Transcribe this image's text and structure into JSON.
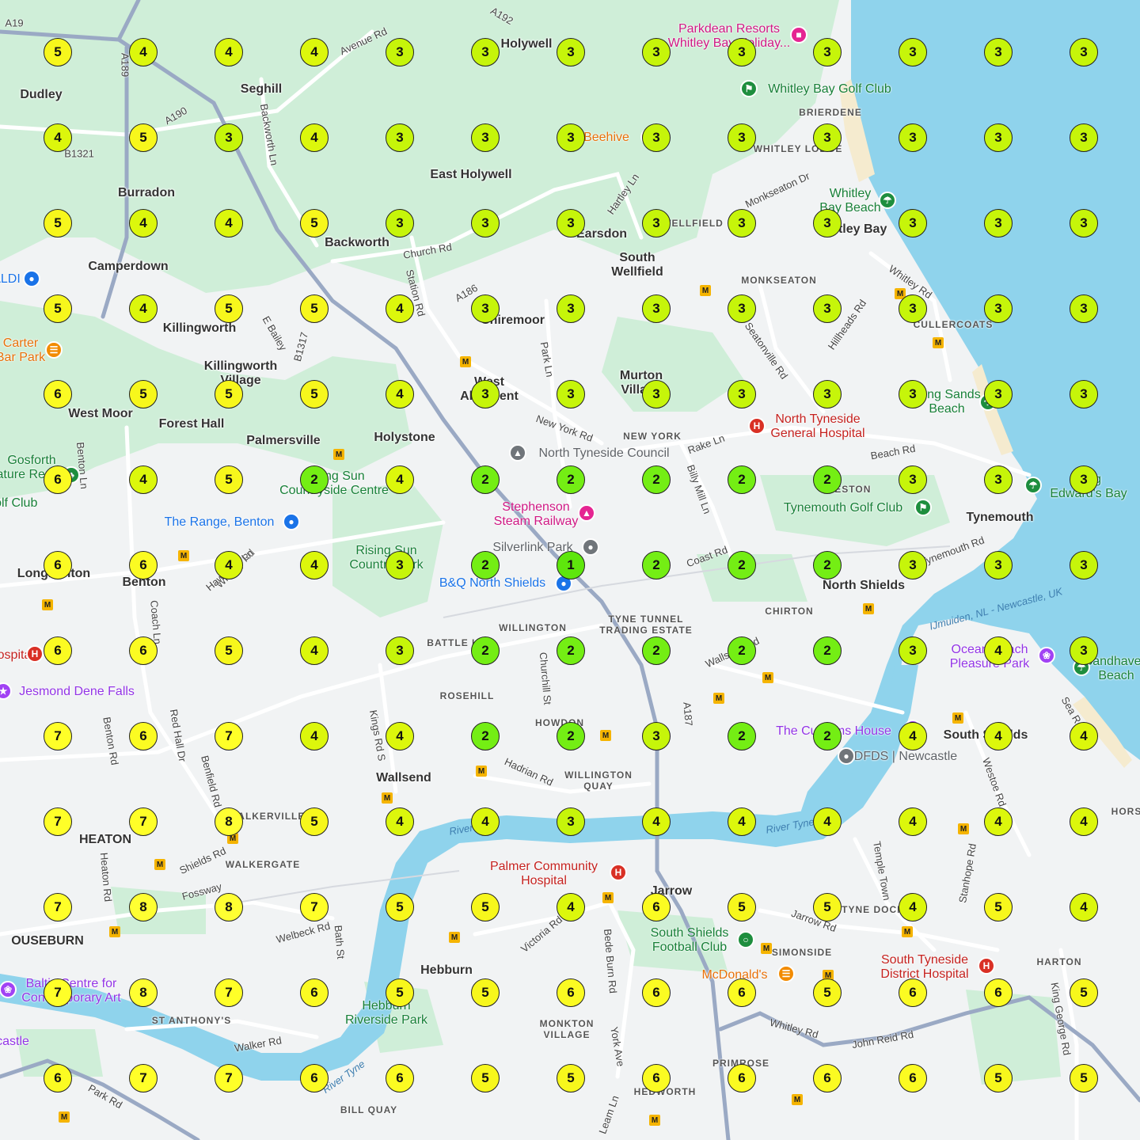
{
  "map": {
    "colors": {
      "land": "#f1f3f4",
      "green": "#c9efd3",
      "sea": "#8fd3ec",
      "road": "#ffffff",
      "major_road": "#9aa9c4",
      "beach": "#f5ebcf"
    },
    "place_labels": [
      {
        "text": "Dudley"
      },
      {
        "text": "Seghill"
      },
      {
        "text": "Holywell"
      },
      {
        "text": "East Holywell"
      },
      {
        "text": "Burradon"
      },
      {
        "text": "Backworth"
      },
      {
        "text": "Earsdon"
      },
      {
        "text": "South\nWellfield"
      },
      {
        "text": "Camperdown"
      },
      {
        "text": "Killingworth"
      },
      {
        "text": "Killingworth\nVillage"
      },
      {
        "text": "Shiremoor"
      },
      {
        "text": "West\nAllotment"
      },
      {
        "text": "Murton\nVillage"
      },
      {
        "text": "West Moor"
      },
      {
        "text": "Forest Hall"
      },
      {
        "text": "Palmersville"
      },
      {
        "text": "Holystone"
      },
      {
        "text": "Whitley Bay"
      },
      {
        "text": "Tynemouth"
      },
      {
        "text": "Longbenton"
      },
      {
        "text": "Benton"
      },
      {
        "text": "North Shields"
      },
      {
        "text": "Wallsend"
      },
      {
        "text": "HEATON"
      },
      {
        "text": "Jarrow"
      },
      {
        "text": "Hebburn"
      },
      {
        "text": "South Shields"
      },
      {
        "text": "OUSEBURN"
      }
    ],
    "area_labels": [
      {
        "text": "BRIERDENE"
      },
      {
        "text": "WHITLEY LODGE"
      },
      {
        "text": "WELLFIELD"
      },
      {
        "text": "MONKSEATON"
      },
      {
        "text": "CULLERCOATS"
      },
      {
        "text": "NEW YORK"
      },
      {
        "text": "PRESTON"
      },
      {
        "text": "CHIRTON"
      },
      {
        "text": "WILLINGTON"
      },
      {
        "text": "TYNE TUNNEL\nTRADING ESTATE"
      },
      {
        "text": "BATTLE HILL"
      },
      {
        "text": "ROSEHILL"
      },
      {
        "text": "HOWDON"
      },
      {
        "text": "WILLINGTON\nQUAY"
      },
      {
        "text": "WALKERVILLE"
      },
      {
        "text": "WALKERGATE"
      },
      {
        "text": "TYNE DOCK"
      },
      {
        "text": "SIMONSIDE"
      },
      {
        "text": "HARTON"
      },
      {
        "text": "ST ANTHONY'S"
      },
      {
        "text": "MONKTON\nVILLAGE"
      },
      {
        "text": "PRIMROSE"
      },
      {
        "text": "HEDWORTH"
      },
      {
        "text": "BILL QUAY"
      },
      {
        "text": "HORS"
      }
    ],
    "road_labels": [
      {
        "text": "A19"
      },
      {
        "text": "A189"
      },
      {
        "text": "A190"
      },
      {
        "text": "B1321"
      },
      {
        "text": "Avenue Rd"
      },
      {
        "text": "Backworth Ln"
      },
      {
        "text": "Church Rd"
      },
      {
        "text": "Station Rd"
      },
      {
        "text": "A186"
      },
      {
        "text": "Hartley Ln"
      },
      {
        "text": "Monkseaton Dr"
      },
      {
        "text": "Whitley Rd"
      },
      {
        "text": "Hillheads Rd"
      },
      {
        "text": "Seatonville Rd"
      },
      {
        "text": "Park Ln"
      },
      {
        "text": "New York Rd"
      },
      {
        "text": "Rake Ln"
      },
      {
        "text": "Billy Mill Ln"
      },
      {
        "text": "Beach Rd"
      },
      {
        "text": "Coast Rd"
      },
      {
        "text": "Tynemouth Rd"
      },
      {
        "text": "B1317"
      },
      {
        "text": "E Bailey"
      },
      {
        "text": "Benton Ln"
      },
      {
        "text": "Coach Ln"
      },
      {
        "text": "Whitley Rd"
      },
      {
        "text": "Churchill St"
      },
      {
        "text": "Kings Rd S"
      },
      {
        "text": "Hadrian Rd"
      },
      {
        "text": "A187"
      },
      {
        "text": "Red Hall Dr"
      },
      {
        "text": "Benfield Rd"
      },
      {
        "text": "Benton Rd"
      },
      {
        "text": "Heaton Rd"
      },
      {
        "text": "Shields Rd"
      },
      {
        "text": "Fossway"
      },
      {
        "text": "Welbeck Rd"
      },
      {
        "text": "Bath St"
      },
      {
        "text": "Victoria Rd"
      },
      {
        "text": "Bede Burn Rd"
      },
      {
        "text": "Jarrow Rd"
      },
      {
        "text": "Temple Town"
      },
      {
        "text": "Stanhope Rd"
      },
      {
        "text": "Westoe Rd"
      },
      {
        "text": "John Reid Rd"
      },
      {
        "text": "King George Rd"
      },
      {
        "text": "York Ave"
      },
      {
        "text": "Leam Ln"
      },
      {
        "text": "Walker Rd"
      },
      {
        "text": "Park Rd"
      },
      {
        "text": "Sea Rd"
      },
      {
        "text": "Wallsend Rd"
      },
      {
        "text": "Whitley Rd"
      },
      {
        "text": "A192"
      },
      {
        "text": "Hawkey's Ln"
      }
    ],
    "water_labels": [
      {
        "text": "River Tyne"
      },
      {
        "text": "River Tyne"
      },
      {
        "text": "River Tyne"
      },
      {
        "text": "IJmuiden, NL - Newcastle, UK"
      }
    ],
    "poi_labels": [
      {
        "text": "Parkdean Resorts\nWhitley Bay Holiday...",
        "style": "pink",
        "icon": "bed-icon"
      },
      {
        "text": "Whitley Bay Golf Club",
        "style": "green",
        "icon": "golf-icon"
      },
      {
        "text": "Beehive",
        "style": "orange",
        "icon": "food-icon"
      },
      {
        "text": "Whitley\nBay Beach",
        "style": "green",
        "icon": "beach-icon"
      },
      {
        "text": "ALDI",
        "style": "blue",
        "icon": "shop-icon"
      },
      {
        "text": "Carter\nBar Park",
        "style": "orange",
        "icon": "food-icon"
      },
      {
        "text": "Long Sands\nBeach",
        "style": "green",
        "icon": "beach-icon"
      },
      {
        "text": "North Tyneside\nGeneral Hospital",
        "style": "red",
        "icon": "hospital-icon"
      },
      {
        "text": "North Tyneside Council",
        "style": "grey",
        "icon": "civic-icon"
      },
      {
        "text": "Gosforth\nNature Reserve",
        "style": "green",
        "icon": "park-icon"
      },
      {
        "text": "Golf Club",
        "style": "green",
        "icon": "golf-icon"
      },
      {
        "text": "Rising Sun\nCountryside Centre",
        "style": "green",
        "icon": "park-icon"
      },
      {
        "text": "King\nEdward's Bay",
        "style": "green",
        "icon": "beach-icon"
      },
      {
        "text": "Stephenson\nSteam Railway",
        "style": "pink",
        "icon": "museum-icon"
      },
      {
        "text": "Tynemouth Golf Club",
        "style": "green",
        "icon": "golf-icon"
      },
      {
        "text": "The Range, Benton",
        "style": "blue",
        "icon": "shop-icon"
      },
      {
        "text": "Silverlink Park",
        "style": "grey",
        "icon": "place-icon"
      },
      {
        "text": "Rising Sun\nCountry Park",
        "style": "green",
        "icon": "park-icon"
      },
      {
        "text": "B&Q North Shields",
        "style": "blue",
        "icon": "shop-icon"
      },
      {
        "text": "Hospital",
        "style": "red",
        "icon": "hospital-icon"
      },
      {
        "text": "Ocean Beach\nPleasure Park",
        "style": "purple",
        "icon": "amusement-icon"
      },
      {
        "text": "Sandhaven\nBeach",
        "style": "green",
        "icon": "beach-icon"
      },
      {
        "text": "Jesmond Dene Falls",
        "style": "purple",
        "icon": "attraction-icon"
      },
      {
        "text": "The Customs House",
        "style": "purple",
        "icon": "theatre-icon"
      },
      {
        "text": "DFDS | Newcastle",
        "style": "grey",
        "icon": "place-icon"
      },
      {
        "text": "Palmer Community\nHospital",
        "style": "red",
        "icon": "hospital-icon"
      },
      {
        "text": "South Shields\nFootball Club",
        "style": "green",
        "icon": "stadium-icon"
      },
      {
        "text": "McDonald's",
        "style": "orange",
        "icon": "food-icon"
      },
      {
        "text": "South Tyneside\nDistrict Hospital",
        "style": "red",
        "icon": "hospital-icon"
      },
      {
        "text": "Baltic Centre for\nContemporary Art",
        "style": "purple",
        "icon": "art-icon"
      },
      {
        "text": "Hebburn\nRiverside Park",
        "style": "green",
        "icon": "park-icon"
      },
      {
        "text": "castle",
        "style": "purple",
        "icon": "castle-icon"
      }
    ]
  },
  "score_grid": {
    "legend_colors": {
      "1": "#5ee60c",
      "2": "#74ee14",
      "3": "#c6f50a",
      "4": "#dcf70c",
      "5": "#f7f71c",
      "6": "#fbfb22",
      "7": "#ffff28",
      "8": "#ffff32"
    },
    "rows": [
      [
        5,
        4,
        4,
        4,
        3,
        3,
        3,
        3,
        3,
        3,
        3,
        3,
        3
      ],
      [
        4,
        5,
        3,
        4,
        3,
        3,
        3,
        3,
        3,
        3,
        3,
        3,
        3
      ],
      [
        5,
        4,
        4,
        5,
        3,
        3,
        3,
        3,
        3,
        3,
        3,
        3,
        3
      ],
      [
        5,
        4,
        5,
        5,
        4,
        3,
        3,
        3,
        3,
        3,
        3,
        3,
        3
      ],
      [
        6,
        5,
        5,
        5,
        4,
        3,
        3,
        3,
        3,
        3,
        3,
        3,
        3
      ],
      [
        6,
        4,
        5,
        2,
        4,
        2,
        2,
        2,
        2,
        2,
        3,
        3,
        3
      ],
      [
        6,
        6,
        4,
        4,
        3,
        2,
        1,
        2,
        2,
        2,
        3,
        3,
        3
      ],
      [
        6,
        6,
        5,
        4,
        3,
        2,
        2,
        2,
        2,
        2,
        3,
        4,
        3
      ],
      [
        7,
        6,
        7,
        4,
        4,
        2,
        2,
        3,
        2,
        2,
        4,
        4,
        4
      ],
      [
        7,
        7,
        8,
        5,
        4,
        4,
        3,
        4,
        4,
        4,
        4,
        4,
        4
      ],
      [
        7,
        8,
        8,
        7,
        5,
        5,
        4,
        6,
        5,
        5,
        4,
        5,
        4
      ],
      [
        7,
        8,
        7,
        6,
        5,
        5,
        6,
        6,
        6,
        5,
        6,
        6,
        5
      ],
      [
        6,
        7,
        7,
        6,
        6,
        5,
        5,
        6,
        6,
        6,
        6,
        5,
        5
      ]
    ]
  }
}
